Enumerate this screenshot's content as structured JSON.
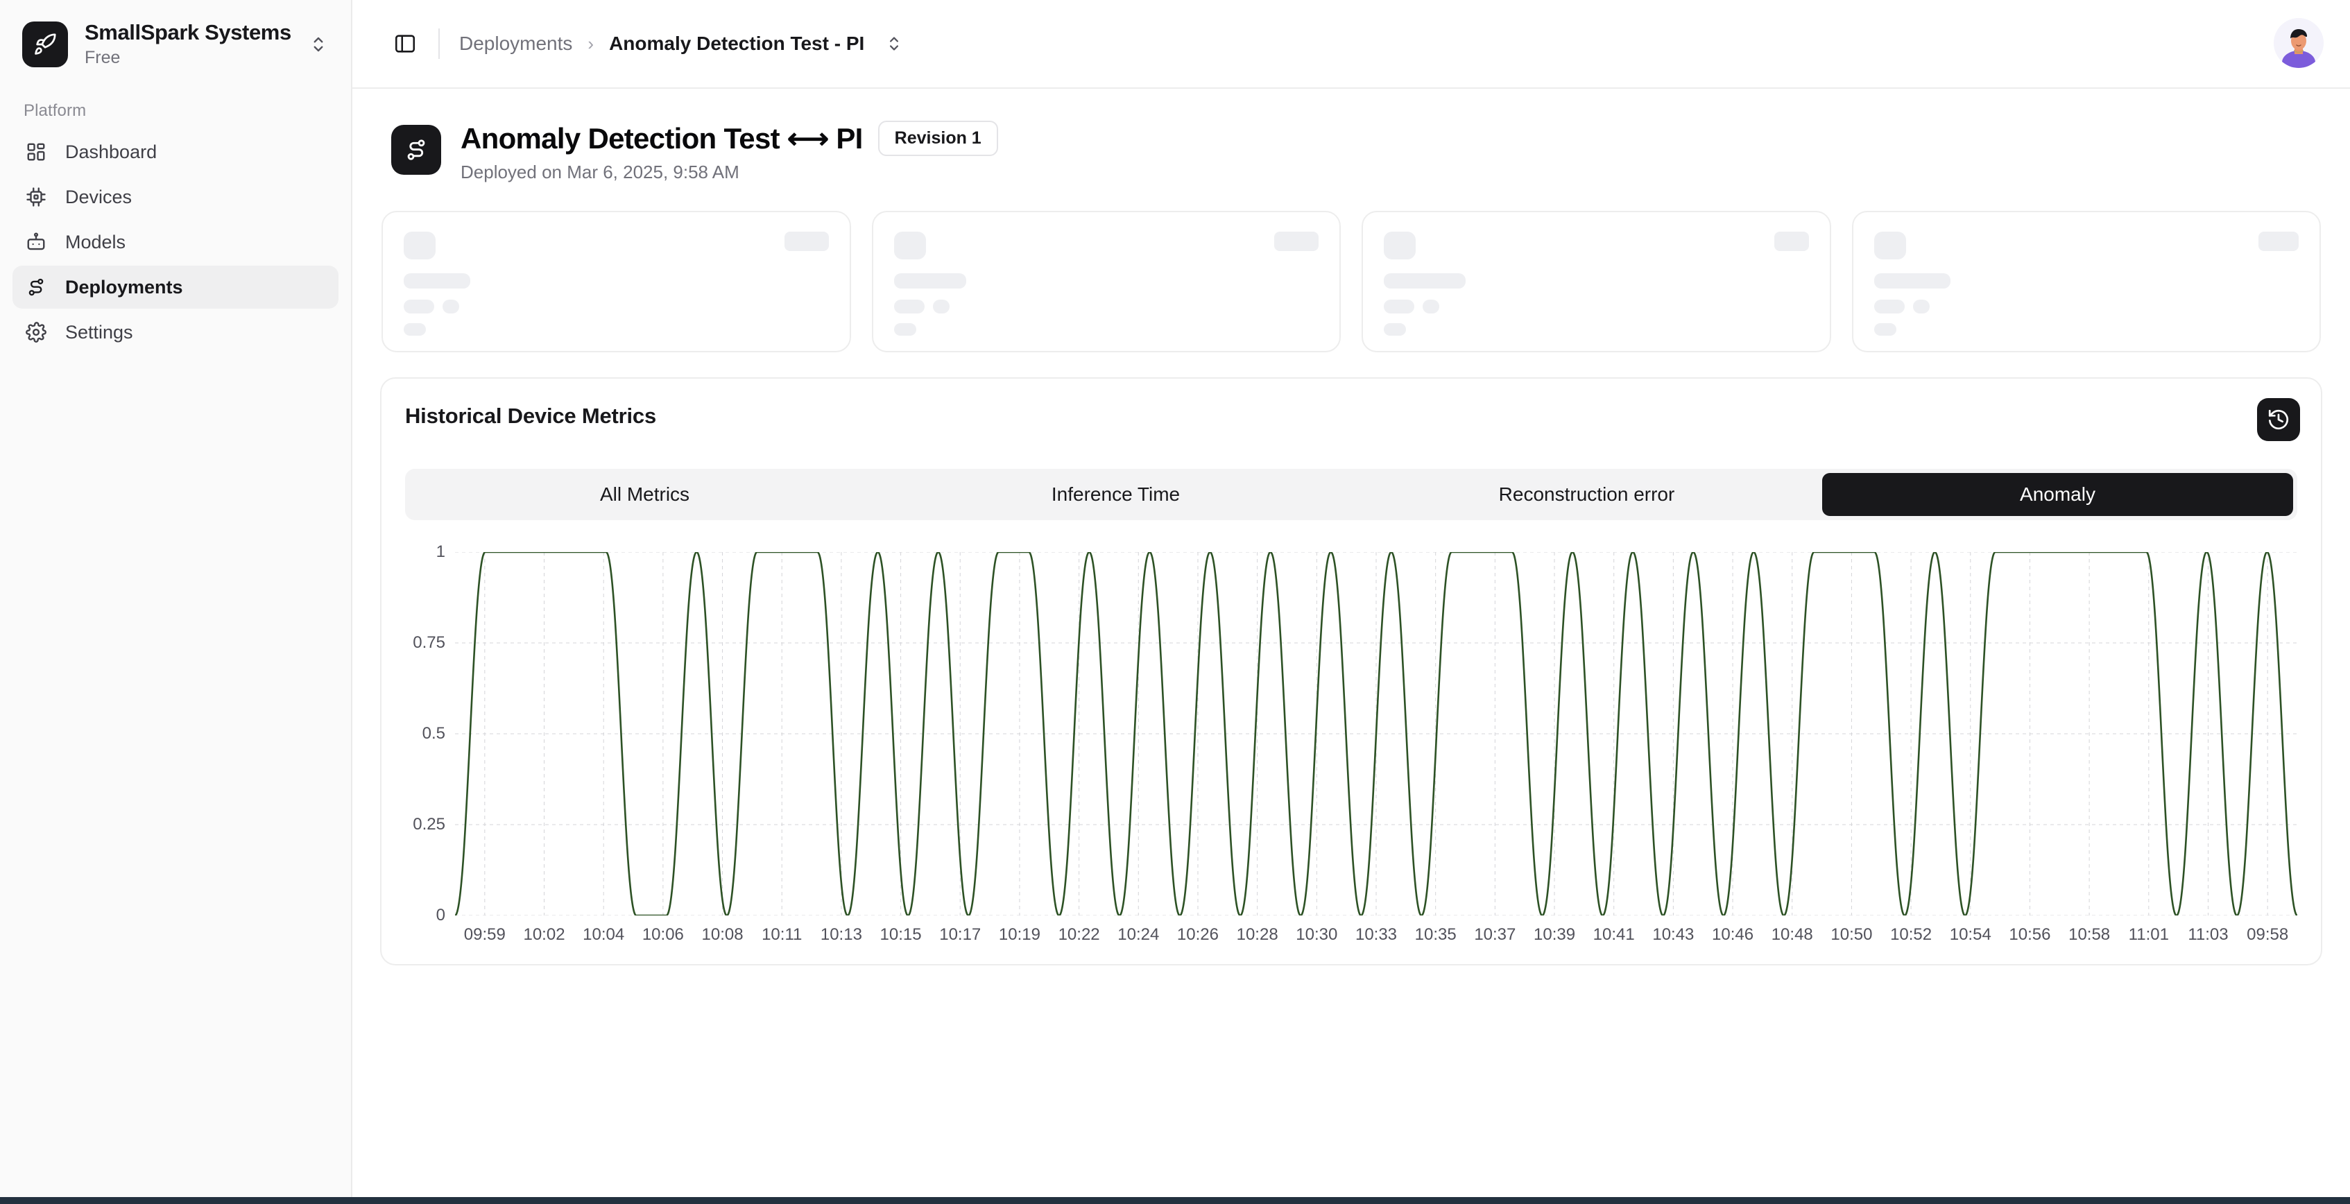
{
  "sidebar": {
    "org": {
      "name": "SmallSpark Systems",
      "plan": "Free",
      "logo_icon": "rocket-icon",
      "switcher_icon": "chevron-up-down-icon"
    },
    "section_label": "Platform",
    "items": [
      {
        "label": "Dashboard",
        "icon": "layout-dashboard-icon",
        "active": false
      },
      {
        "label": "Devices",
        "icon": "cpu-chip-icon",
        "active": false
      },
      {
        "label": "Models",
        "icon": "robot-icon",
        "active": false
      },
      {
        "label": "Deployments",
        "icon": "deployment-nodes-icon",
        "active": true
      },
      {
        "label": "Settings",
        "icon": "gear-icon",
        "active": false
      }
    ]
  },
  "topbar": {
    "panel_toggle_icon": "sidebar-panel-icon",
    "breadcrumb": {
      "parent": "Deployments",
      "separator": "›",
      "current": "Anomaly Detection Test - PI",
      "switcher_icon": "chevron-up-down-icon"
    },
    "avatar_name": "user-avatar"
  },
  "page": {
    "icon": "deployment-nodes-icon",
    "title": "Anomaly Detection Test ⟷ PI",
    "revision_badge": "Revision 1",
    "subtitle": "Deployed on Mar 6, 2025, 9:58 AM"
  },
  "skeleton_cards": [
    {
      "name": "skeleton-card-1"
    },
    {
      "name": "skeleton-card-2"
    },
    {
      "name": "skeleton-card-3"
    },
    {
      "name": "skeleton-card-4"
    }
  ],
  "metrics": {
    "title": "Historical Device Metrics",
    "history_button_icon": "history-clock-icon",
    "tabs": [
      {
        "label": "All Metrics",
        "active": false
      },
      {
        "label": "Inference Time",
        "active": false
      },
      {
        "label": "Reconstruction error",
        "active": false
      },
      {
        "label": "Anomaly",
        "active": true
      }
    ]
  },
  "colors": {
    "line": "#2d5225",
    "grid": "#d4d4d8",
    "accent_dark": "#18181b",
    "skeleton": "#eeeff2",
    "panel_border": "#ededed",
    "avatar_shirt": "#7c5cdb"
  },
  "chart_data": {
    "type": "line",
    "title": "Anomaly",
    "xlabel": "",
    "ylabel": "",
    "ylim": [
      0,
      1
    ],
    "yticks": [
      "0",
      "0.25",
      "0.5",
      "0.75",
      "1"
    ],
    "ytick_values": [
      0,
      0.25,
      0.5,
      0.75,
      1
    ],
    "grid": true,
    "legend": "none",
    "series_name": "Anomaly",
    "line_color": "#2d5225",
    "xticks": [
      "09:59",
      "10:02",
      "10:04",
      "10:06",
      "10:08",
      "10:11",
      "10:13",
      "10:15",
      "10:17",
      "10:19",
      "10:22",
      "10:24",
      "10:26",
      "10:28",
      "10:30",
      "10:33",
      "10:35",
      "10:37",
      "10:39",
      "10:41",
      "10:43",
      "10:46",
      "10:48",
      "10:50",
      "10:52",
      "10:54",
      "10:56",
      "10:58",
      "11:01",
      "11:03",
      "09:58"
    ],
    "values": [
      0,
      1,
      1,
      1,
      1,
      1,
      0,
      0,
      1,
      0,
      1,
      1,
      1,
      0,
      1,
      0,
      1,
      0,
      1,
      1,
      0,
      1,
      0,
      1,
      0,
      1,
      0,
      1,
      0,
      1,
      0,
      1,
      0,
      1,
      1,
      1,
      0,
      1,
      0,
      1,
      0,
      1,
      0,
      1,
      0,
      1,
      1,
      1,
      0,
      1,
      0,
      1,
      1,
      1,
      1,
      1,
      1,
      0,
      1,
      0,
      1,
      0
    ],
    "x_index": [
      0,
      1,
      2,
      3,
      4,
      5,
      6,
      7,
      8,
      9,
      10,
      11,
      12,
      13,
      14,
      15,
      16,
      17,
      18,
      19,
      20,
      21,
      22,
      23,
      24,
      25,
      26,
      27,
      28,
      29,
      30,
      31,
      32,
      33,
      34,
      35,
      36,
      37,
      38,
      39,
      40,
      41,
      42,
      43,
      44,
      45,
      46,
      47,
      48,
      49,
      50,
      51,
      52,
      53,
      54,
      55,
      56,
      57,
      58,
      59,
      60,
      61
    ]
  }
}
